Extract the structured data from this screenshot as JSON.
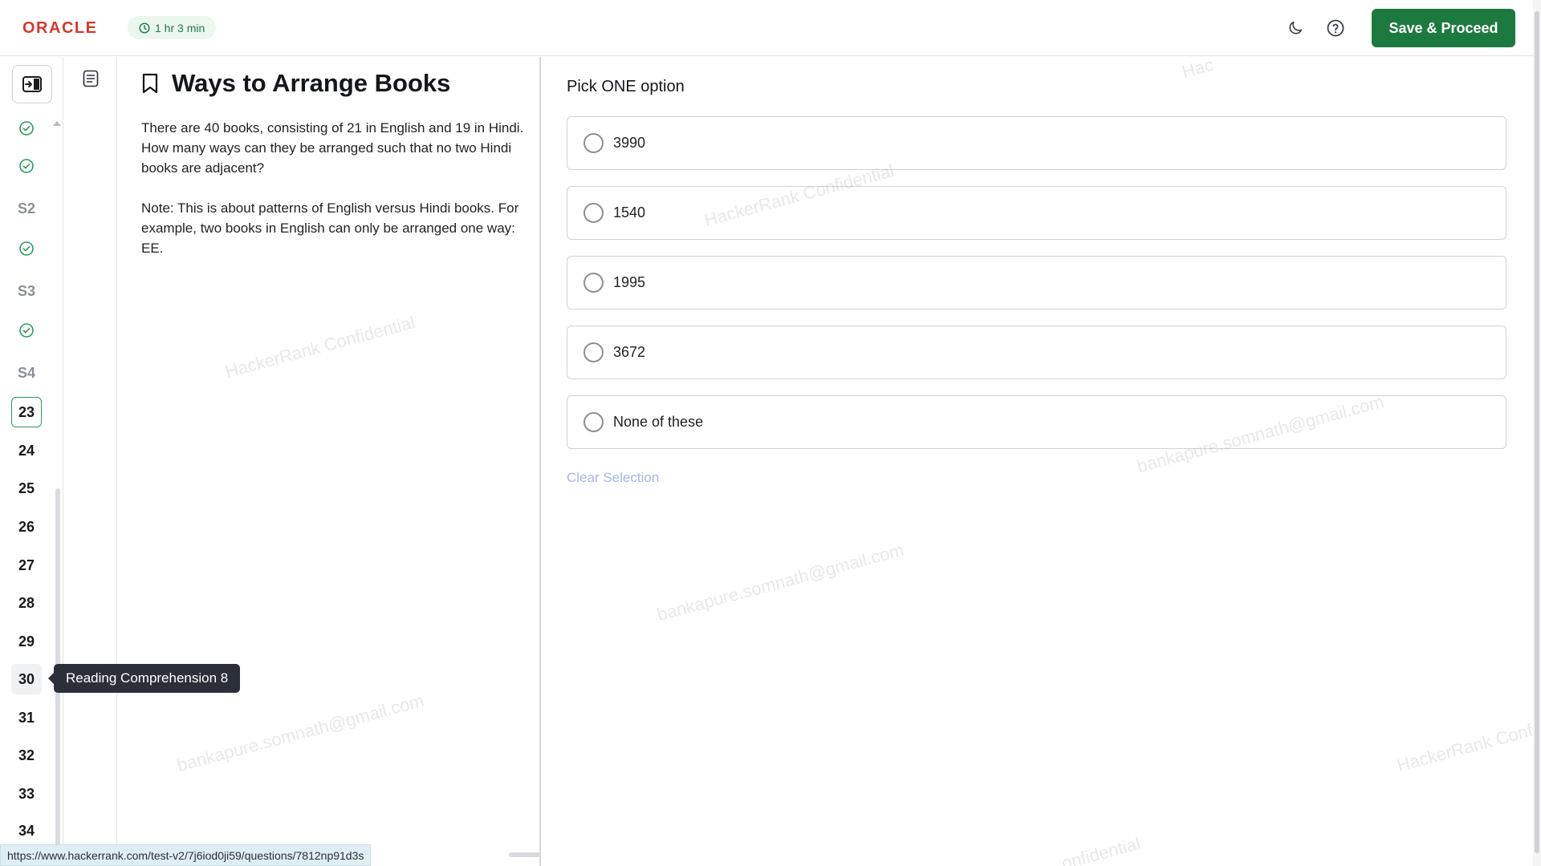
{
  "header": {
    "logo": "ORACLE",
    "timer": "1 hr 3 min",
    "save_label": "Save & Proceed"
  },
  "rail": {
    "items": [
      {
        "type": "check"
      },
      {
        "type": "check"
      },
      {
        "type": "section",
        "label": "S2"
      },
      {
        "type": "check"
      },
      {
        "type": "section",
        "label": "S3"
      },
      {
        "type": "check"
      },
      {
        "type": "section",
        "label": "S4"
      },
      {
        "type": "number",
        "label": "23",
        "state": "current"
      },
      {
        "type": "number",
        "label": "24"
      },
      {
        "type": "number",
        "label": "25"
      },
      {
        "type": "number",
        "label": "26"
      },
      {
        "type": "number",
        "label": "27"
      },
      {
        "type": "number",
        "label": "28"
      },
      {
        "type": "number",
        "label": "29"
      },
      {
        "type": "number",
        "label": "30",
        "state": "hover"
      },
      {
        "type": "number",
        "label": "31"
      },
      {
        "type": "number",
        "label": "32"
      },
      {
        "type": "number",
        "label": "33"
      },
      {
        "type": "number",
        "label": "34"
      }
    ],
    "tooltip": "Reading Comprehension 8"
  },
  "question": {
    "title": "Ways to Arrange Books",
    "paragraphs": [
      "There are 40 books, consisting of 21 in English and 19 in Hindi. How many ways can they be arranged such that no two Hindi books are adjacent?",
      "Note: This is about patterns of English versus Hindi books. For example, two books in English can only be arranged one way: EE."
    ]
  },
  "answer": {
    "prompt": "Pick ONE option",
    "options": [
      "3990",
      "1540",
      "1995",
      "3672",
      "None of these"
    ],
    "clear_label": "Clear Selection"
  },
  "watermarks": [
    "HackerRank Confidential",
    "HackerRank Confidential",
    "bankapure.somnath@gmail.com",
    "bankapure.somnath@gmail.com",
    "bankapure.somnath@gmail.com",
    "HackerRank Conf",
    "Hac",
    "onfidential"
  ],
  "status_url": "https://www.hackerrank.com/test-v2/7j6iod0ji59/questions/7812np91d3s",
  "colors": {
    "brand": "#d9382b",
    "primary_button": "#1d7a3f",
    "check": "#2e9a5a"
  }
}
